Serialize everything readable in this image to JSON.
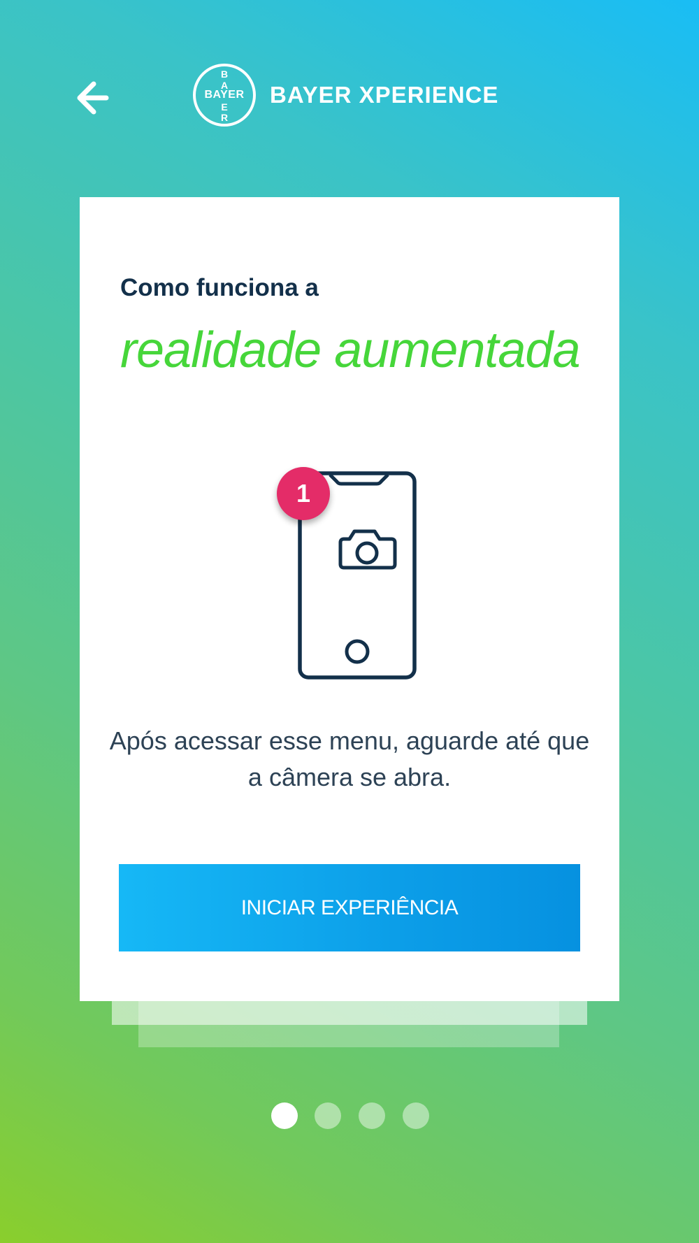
{
  "header": {
    "back_icon": "arrow-left-icon",
    "logo": {
      "horizontal_text": "BAYER",
      "vertical_letters": [
        "B",
        "A",
        "",
        "E",
        "R"
      ]
    },
    "brand_name": "BAYER XPERIENCE"
  },
  "card": {
    "subtitle": "Como funciona a",
    "title": "realidade aumentada",
    "illustration_icon": "smartphone-camera-icon",
    "step_number": "1",
    "description": "Após acessar esse menu, aguarde até que a câmera se abra.",
    "button_label": "INICIAR EXPERIÊNCIA"
  },
  "pagination": {
    "total": 4,
    "current_index": 0
  },
  "colors": {
    "gradient_top": "#19bdf5",
    "gradient_bottom": "#8ace2c",
    "title_green": "#46d63a",
    "subtitle_navy": "#13304a",
    "badge_pink": "#e42c68",
    "button_blue": "#0c9ee8"
  }
}
